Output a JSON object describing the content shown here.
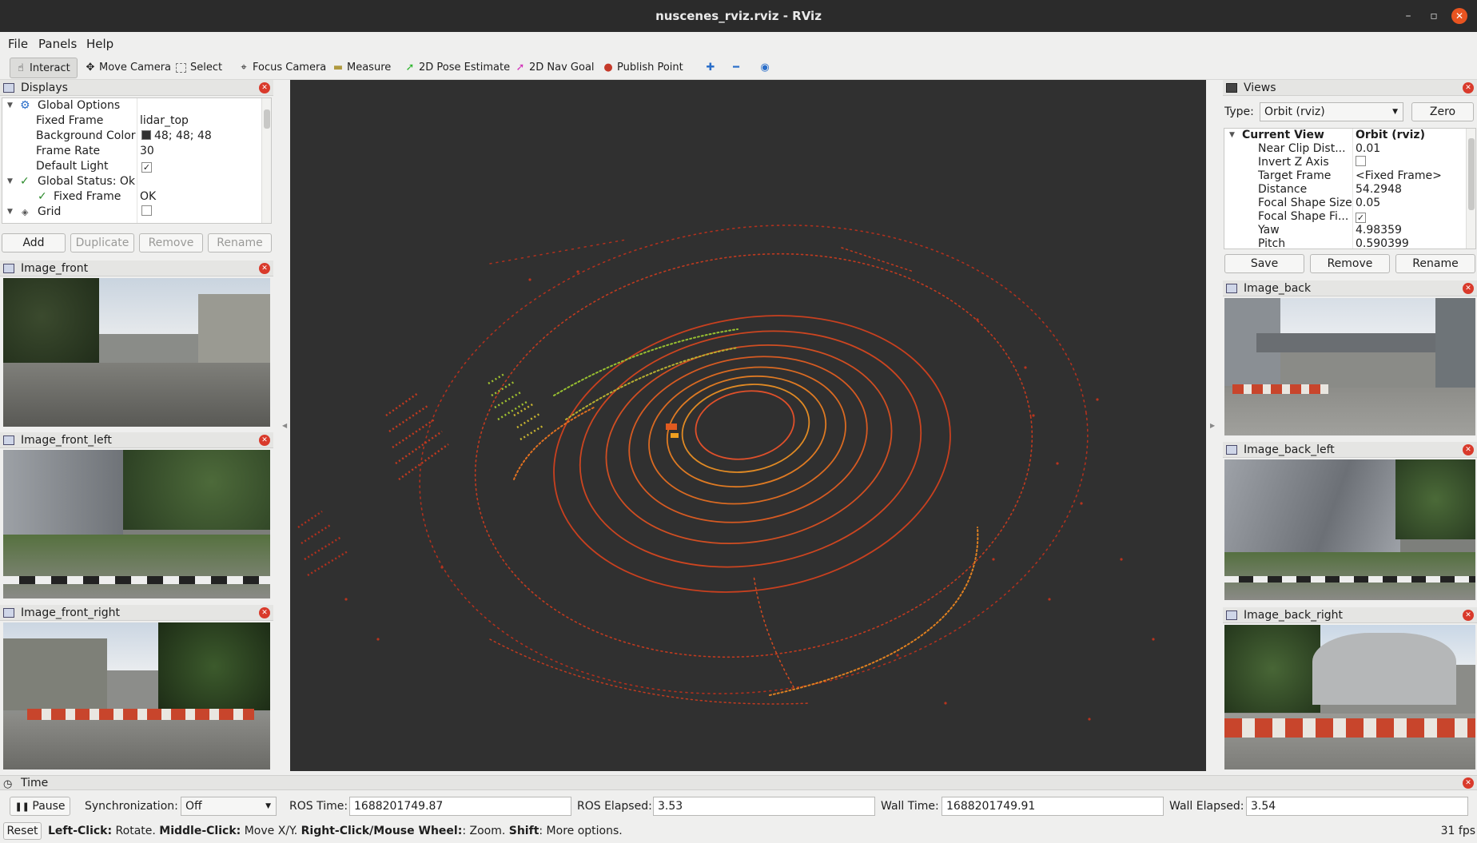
{
  "window": {
    "title": "nuscenes_rviz.rviz - RViz"
  },
  "menu": [
    "File",
    "Panels",
    "Help"
  ],
  "toolbar": {
    "tools": [
      "Interact",
      "Move Camera",
      "Select",
      "Focus Camera",
      "Measure",
      "2D Pose Estimate",
      "2D Nav Goal",
      "Publish Point"
    ]
  },
  "displays": {
    "title": "Displays",
    "rows": {
      "global_options": "Global Options",
      "fixed_frame_key": "Fixed Frame",
      "fixed_frame_val": "lidar_top",
      "bg_key": "Background Color",
      "bg_val": "48; 48; 48",
      "rate_key": "Frame Rate",
      "rate_val": "30",
      "light_key": "Default Light",
      "status": "Global Status: Ok",
      "status_ff_key": "Fixed Frame",
      "status_ff_val": "OK",
      "grid": "Grid"
    },
    "buttons": {
      "add": "Add",
      "duplicate": "Duplicate",
      "remove": "Remove",
      "rename": "Rename"
    }
  },
  "left_images": [
    "Image_front",
    "Image_front_left",
    "Image_front_right"
  ],
  "views": {
    "title": "Views",
    "type_label": "Type:",
    "type_value": "Orbit (rviz)",
    "zero": "Zero",
    "current_view": "Current View",
    "current_view_val": "Orbit (rviz)",
    "props": [
      {
        "k": "Near Clip Dist...",
        "v": "0.01"
      },
      {
        "k": "Invert Z Axis",
        "v": ""
      },
      {
        "k": "Target Frame",
        "v": "<Fixed Frame>"
      },
      {
        "k": "Distance",
        "v": "54.2948"
      },
      {
        "k": "Focal Shape Size",
        "v": "0.05"
      },
      {
        "k": "Focal Shape Fi...",
        "v": ""
      },
      {
        "k": "Yaw",
        "v": "4.98359"
      },
      {
        "k": "Pitch",
        "v": "0.590399"
      }
    ],
    "buttons": {
      "save": "Save",
      "remove": "Remove",
      "rename": "Rename"
    }
  },
  "right_images": [
    "Image_back",
    "Image_back_left",
    "Image_back_right"
  ],
  "time": {
    "title": "Time",
    "pause": "Pause",
    "sync_label": "Synchronization:",
    "sync_value": "Off",
    "ros_time_label": "ROS Time:",
    "ros_time": "1688201749.87",
    "ros_elapsed_label": "ROS Elapsed:",
    "ros_elapsed": "3.53",
    "wall_time_label": "Wall Time:",
    "wall_time": "1688201749.91",
    "wall_elapsed_label": "Wall Elapsed:",
    "wall_elapsed": "3.54"
  },
  "status": {
    "reset": "Reset",
    "h1": "Left-Click:",
    "t1": " Rotate. ",
    "h2": "Middle-Click:",
    "t2": " Move X/Y. ",
    "h3": "Right-Click/Mouse Wheel:",
    "t3": ": Zoom. ",
    "h4": "Shift",
    "t4": ": More options.",
    "fps": "31 fps"
  },
  "colors": {
    "viewport_bg": "#303030",
    "accent": "#e95420",
    "close": "#d93a2b"
  }
}
